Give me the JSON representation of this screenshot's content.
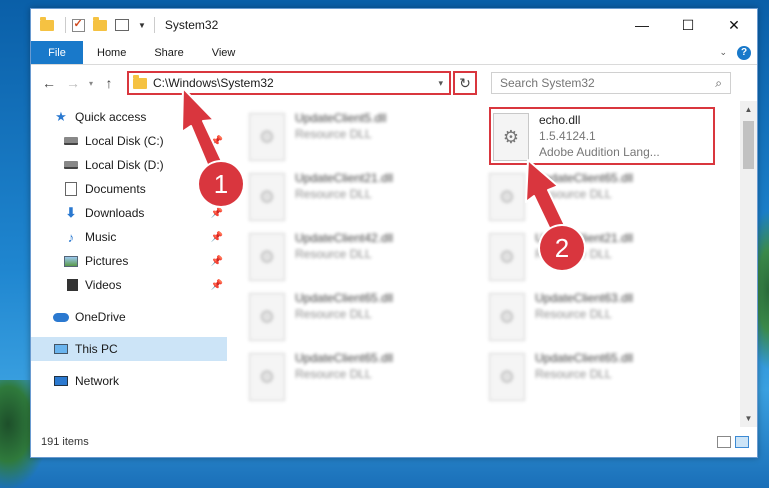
{
  "window": {
    "title": "System32",
    "controls": {
      "minimize": "—",
      "maximize": "☐",
      "close": "✕"
    }
  },
  "ribbon": {
    "tabs": [
      "File",
      "Home",
      "Share",
      "View"
    ],
    "help": "?"
  },
  "address": {
    "path": "C:\\Windows\\System32",
    "search_placeholder": "Search System32"
  },
  "nav_pane": {
    "quick_access": "Quick access",
    "items": [
      {
        "label": "Local Disk (C:)",
        "pinned": true
      },
      {
        "label": "Local Disk (D:)",
        "pinned": false
      },
      {
        "label": "Documents",
        "pinned": true
      },
      {
        "label": "Downloads",
        "pinned": true
      },
      {
        "label": "Music",
        "pinned": true
      },
      {
        "label": "Pictures",
        "pinned": true
      },
      {
        "label": "Videos",
        "pinned": true
      }
    ],
    "onedrive": "OneDrive",
    "this_pc": "This PC",
    "network": "Network"
  },
  "files": {
    "highlighted": {
      "name": "echo.dll",
      "version": "1.5.4124.1",
      "description": "Adobe Audition Lang..."
    },
    "left_column": [
      {
        "name": "UpdateClient5.dll",
        "type": "Resource DLL"
      },
      {
        "name": "UpdateClient21.dll",
        "type": "Resource DLL"
      },
      {
        "name": "UpdateClient42.dll",
        "type": "Resource DLL"
      },
      {
        "name": "UpdateClient65.dll",
        "type": "Resource DLL"
      },
      {
        "name": "UpdateClient65.dll",
        "type": "Resource DLL"
      }
    ],
    "right_column": [
      {
        "name": "UpdateClient65.dll",
        "type": "Resource DLL"
      },
      {
        "name": "UpdateClient21.dll",
        "type": "Resource DLL"
      },
      {
        "name": "UpdateClient63.dll",
        "type": "Resource DLL"
      },
      {
        "name": "UpdateClient65.dll",
        "type": "Resource DLL"
      }
    ]
  },
  "status": {
    "item_count": "191 items"
  },
  "annotations": {
    "badge1": "1",
    "badge2": "2",
    "color": "#d9363e"
  }
}
